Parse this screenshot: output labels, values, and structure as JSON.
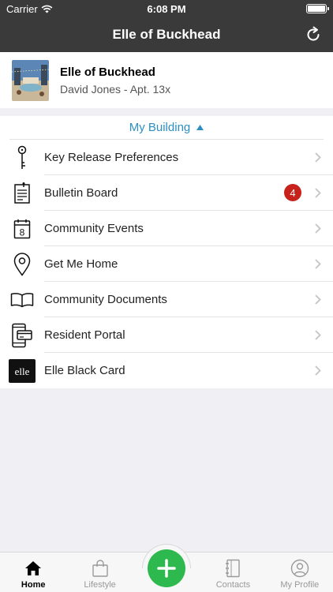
{
  "status_bar": {
    "carrier": "Carrier",
    "time": "6:08 PM"
  },
  "nav": {
    "title": "Elle of Buckhead"
  },
  "property": {
    "name": "Elle of Buckhead",
    "resident": "David Jones - Apt. 13x"
  },
  "section": {
    "title": "My Building",
    "items": [
      {
        "label": "Key Release Preferences",
        "icon": "key-icon"
      },
      {
        "label": "Bulletin Board",
        "icon": "bulletin-icon",
        "badge": "4"
      },
      {
        "label": "Community Events",
        "icon": "calendar-icon",
        "calendar_day": "8"
      },
      {
        "label": "Get Me Home",
        "icon": "map-pin-icon"
      },
      {
        "label": "Community Documents",
        "icon": "book-icon"
      },
      {
        "label": "Resident Portal",
        "icon": "portal-icon"
      },
      {
        "label": "Elle Black Card",
        "icon": "elle-card-icon",
        "logo_text": "elle"
      }
    ]
  },
  "tabs": [
    {
      "label": "Home",
      "icon": "home-icon",
      "active": true
    },
    {
      "label": "Lifestyle",
      "icon": "shopping-bag-icon",
      "active": false
    },
    {
      "label": "",
      "icon": "plus-icon",
      "active": false
    },
    {
      "label": "Contacts",
      "icon": "contacts-book-icon",
      "active": false
    },
    {
      "label": "My Profile",
      "icon": "profile-icon",
      "active": false
    }
  ],
  "colors": {
    "header": "#3a3a3a",
    "accent": "#2b8fc4",
    "badge": "#c8221d",
    "fab": "#2eb94e"
  }
}
